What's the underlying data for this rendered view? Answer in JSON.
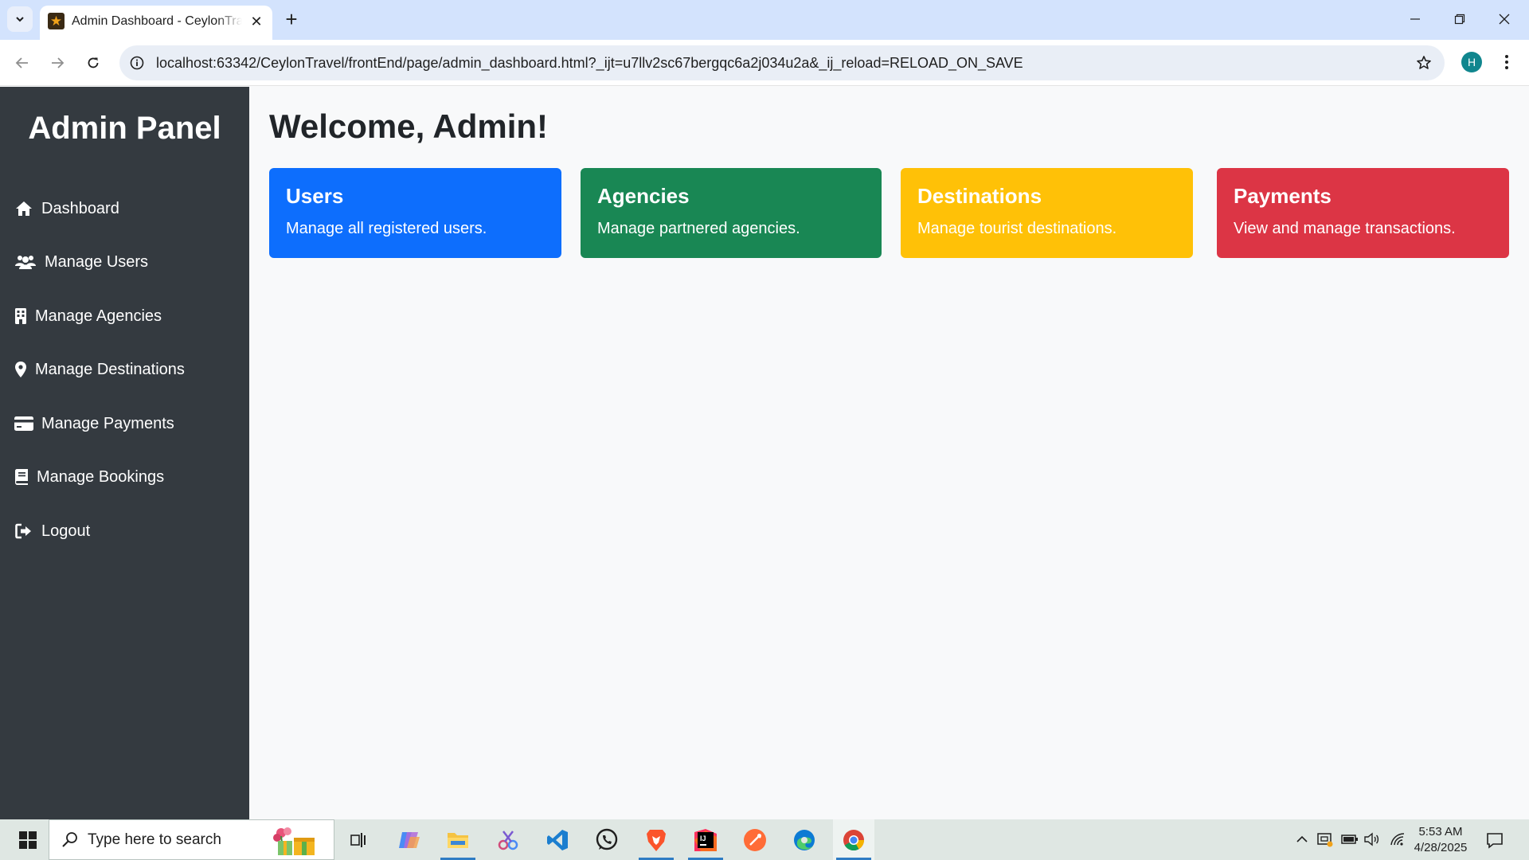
{
  "browser": {
    "tab_title": "Admin Dashboard - CeylonTravel",
    "url": "localhost:63342/CeylonTravel/frontEnd/page/admin_dashboard.html?_ijt=u7llv2sc67bergqc6a2j034u2a&_ij_reload=RELOAD_ON_SAVE",
    "profile_initial": "H"
  },
  "sidebar": {
    "brand": "Admin Panel",
    "items": [
      {
        "label": "Dashboard",
        "icon": "home-icon"
      },
      {
        "label": "Manage Users",
        "icon": "users-icon"
      },
      {
        "label": "Manage Agencies",
        "icon": "building-icon"
      },
      {
        "label": "Manage Destinations",
        "icon": "map-pin-icon"
      },
      {
        "label": "Manage Payments",
        "icon": "credit-card-icon"
      },
      {
        "label": "Manage Bookings",
        "icon": "book-icon"
      },
      {
        "label": "Logout",
        "icon": "logout-icon"
      }
    ]
  },
  "main": {
    "heading": "Welcome, Admin!",
    "cards": [
      {
        "title": "Users",
        "text": "Manage all registered users.",
        "color": "#0d6efd"
      },
      {
        "title": "Agencies",
        "text": "Manage partnered agencies.",
        "color": "#198754"
      },
      {
        "title": "Destinations",
        "text": "Manage tourist destinations.",
        "color": "#ffc107"
      },
      {
        "title": "Payments",
        "text": "View and manage transactions.",
        "color": "#dc3545"
      }
    ]
  },
  "taskbar": {
    "search_placeholder": "Type here to search",
    "time": "5:53 AM",
    "date": "4/28/2025"
  }
}
